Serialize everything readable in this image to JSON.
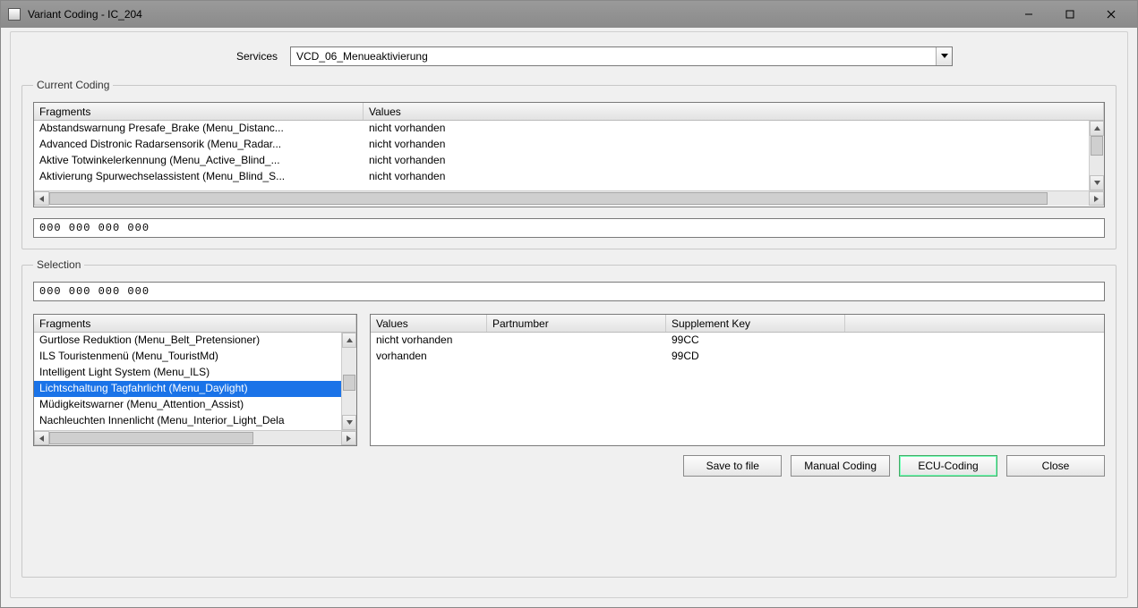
{
  "window": {
    "title": "Variant Coding - IC_204"
  },
  "labels": {
    "services": "Services"
  },
  "services": {
    "selected": "VCD_06_Menueaktivierung"
  },
  "current_coding": {
    "legend": "Current Coding",
    "columns": {
      "fragments": "Fragments",
      "values": "Values"
    },
    "rows": [
      {
        "fragment": "Abstandswarnung Presafe_Brake (Menu_Distanc...",
        "value": "nicht vorhanden"
      },
      {
        "fragment": "Advanced Distronic Radarsensorik (Menu_Radar...",
        "value": "nicht vorhanden"
      },
      {
        "fragment": "Aktive Totwinkelerkennung (Menu_Active_Blind_...",
        "value": "nicht vorhanden"
      },
      {
        "fragment": "Aktivierung Spurwechselassistent (Menu_Blind_S...",
        "value": "nicht vorhanden"
      }
    ],
    "hex": "000 000 000 000"
  },
  "selection": {
    "legend": "Selection",
    "hex": "000 000 000 000",
    "fragments_header": "Fragments",
    "fragments": [
      {
        "label": "Gurtlose Reduktion (Menu_Belt_Pretensioner)",
        "selected": false
      },
      {
        "label": "ILS Touristenmenü (Menu_TouristMd)",
        "selected": false
      },
      {
        "label": "Intelligent Light System (Menu_ILS)",
        "selected": false
      },
      {
        "label": "Lichtschaltung Tagfahrlicht (Menu_Daylight)",
        "selected": true
      },
      {
        "label": "Müdigkeitswarner (Menu_Attention_Assist)",
        "selected": false
      },
      {
        "label": "Nachleuchten Innenlicht (Menu_Interior_Light_Dela",
        "selected": false
      }
    ],
    "value_columns": {
      "values": "Values",
      "partnumber": "Partnumber",
      "supplement_key": "Supplement Key"
    },
    "value_rows": [
      {
        "value": "nicht vorhanden",
        "partnumber": "",
        "supplement_key": "99CC"
      },
      {
        "value": "vorhanden",
        "partnumber": "",
        "supplement_key": "99CD"
      }
    ]
  },
  "buttons": {
    "save_to_file": "Save to file",
    "manual_coding": "Manual Coding",
    "ecu_coding": "ECU-Coding",
    "close": "Close"
  }
}
